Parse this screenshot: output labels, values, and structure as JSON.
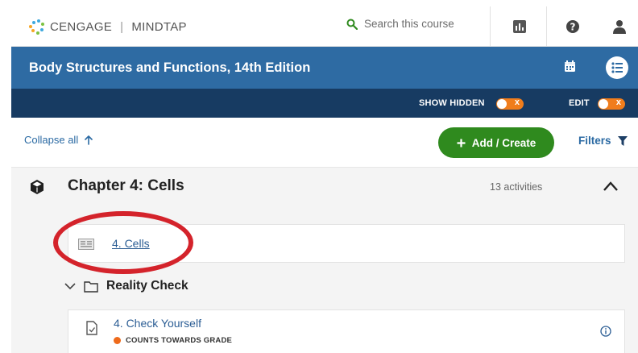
{
  "colors": {
    "title_bar": "#2e6ba3",
    "sub_bar": "#173b62",
    "add_button": "#2f8a1e",
    "toggle": "#f07d1c",
    "link": "#2b5d94",
    "grade_dot": "#ee6a1b",
    "highlight": "#d4232b"
  },
  "header": {
    "brand_left": "CENGAGE",
    "brand_right": "MINDTAP",
    "search_placeholder": "Search this course",
    "icons": [
      "gradebook-icon",
      "help-icon",
      "user-icon"
    ]
  },
  "course": {
    "title": "Body Structures and Functions, 14th Edition"
  },
  "toolbar": {
    "show_hidden_label": "SHOW HIDDEN",
    "edit_label": "EDIT",
    "toggle_off_glyph": "x"
  },
  "controls": {
    "collapse_label": "Collapse all",
    "add_label": "Add / Create",
    "filters_label": "Filters"
  },
  "chapter": {
    "title": "Chapter 4: Cells",
    "activity_count": "13 activities",
    "items": [
      {
        "label": "4. Cells",
        "icon": "page-icon"
      }
    ],
    "folder": {
      "label": "Reality Check",
      "items": [
        {
          "label": "4. Check Yourself",
          "status": "COUNTS TOWARDS GRADE",
          "icon": "document-icon"
        }
      ]
    }
  }
}
